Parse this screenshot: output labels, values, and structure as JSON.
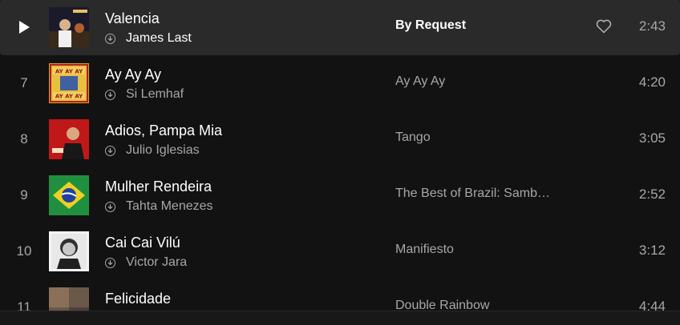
{
  "tracks": [
    {
      "number": "",
      "title": "Valencia",
      "artist": "James Last",
      "album": "By Request",
      "duration": "2:43",
      "active": true
    },
    {
      "number": "7",
      "title": "Ay Ay Ay",
      "artist": "Si Lemhaf",
      "album": "Ay Ay Ay",
      "duration": "4:20"
    },
    {
      "number": "8",
      "title": "Adios, Pampa Mia",
      "artist": "Julio Iglesias",
      "album": "Tango",
      "duration": "3:05"
    },
    {
      "number": "9",
      "title": "Mulher Rendeira",
      "artist": "Tahta Menezes",
      "album": "The Best of Brazil: Samb…",
      "duration": "2:52"
    },
    {
      "number": "10",
      "title": "Cai Cai Vilú",
      "artist": "Victor Jara",
      "album": "Manifiesto",
      "duration": "3:12"
    },
    {
      "number": "11",
      "title": "Felicidade",
      "artist": "",
      "album": "Double Rainbow",
      "duration": "4:44"
    }
  ],
  "icons": {
    "play": "play-icon",
    "download": "download-icon",
    "like": "heart-icon"
  },
  "colors": {
    "background": "#121212",
    "row_hover": "#2a2a2a",
    "text_primary": "#ffffff",
    "text_secondary": "#a7a7a7"
  }
}
